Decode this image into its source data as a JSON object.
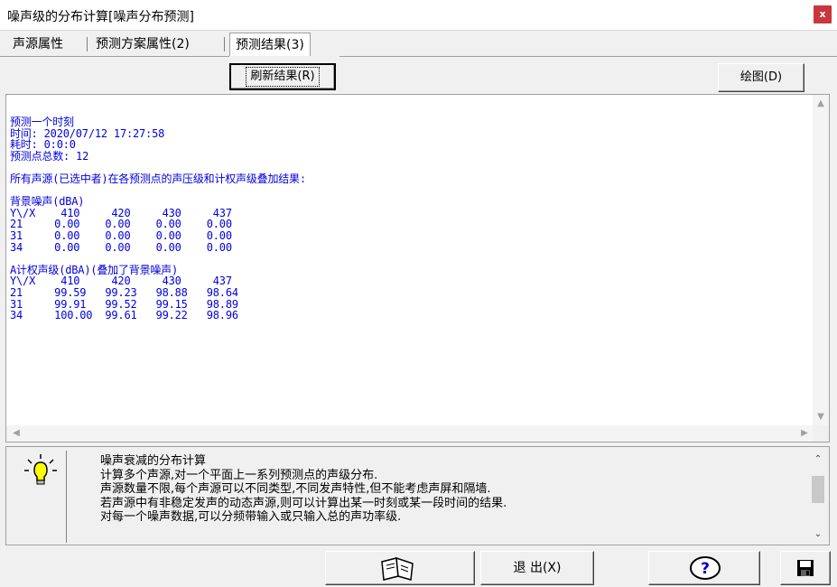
{
  "window": {
    "title": "噪声级的分布计算[噪声分布预测]",
    "close_label": "x"
  },
  "tabs": [
    {
      "label": "声源属性"
    },
    {
      "label": "预测方案属性(2)"
    },
    {
      "label": "预测结果(3)"
    }
  ],
  "toolbar": {
    "refresh_label": "刷新结果(R)",
    "plot_label": "绘图(D)"
  },
  "result": {
    "lines": [
      "预测一个时刻",
      "时间: 2020/07/12 17:27:58",
      "耗时: 0:0:0",
      "预测点总数: 12",
      "",
      "所有声源(已选中者)在各预测点的声压级和计权声级叠加结果:",
      "",
      "背景噪声(dBA)",
      "Y\\/X    410     420     430     437",
      "21     0.00    0.00    0.00    0.00",
      "31     0.00    0.00    0.00    0.00",
      "34     0.00    0.00    0.00    0.00",
      "",
      "A计权声级(dBA)(叠加了背景噪声)",
      "Y\\/X    410     420     430     437",
      "21     99.59   99.23   98.88   98.64",
      "31     99.91   99.52   99.15   98.89",
      "34     100.00  99.61   99.22   98.96"
    ]
  },
  "help": {
    "lines": [
      "噪声衰减的分布计算",
      "计算多个声源,对一个平面上一系列预测点的声级分布.",
      "声源数量不限,每个声源可以不同类型,不同发声特性,但不能考虑声屏和隔墙.",
      "若声源中有非稳定发声的动态声源,则可以计算出某一时刻或某一段时间的结果.",
      "对每一个噪声数据,可以分频带输入或只输入总的声功率级."
    ]
  },
  "bottom": {
    "exit_label": "退 出(X)",
    "help_glyph": "?"
  },
  "icons": {
    "bulb": "lightbulb-icon",
    "book": "book-icon",
    "help": "help-icon",
    "save": "floppy-disk-icon"
  }
}
